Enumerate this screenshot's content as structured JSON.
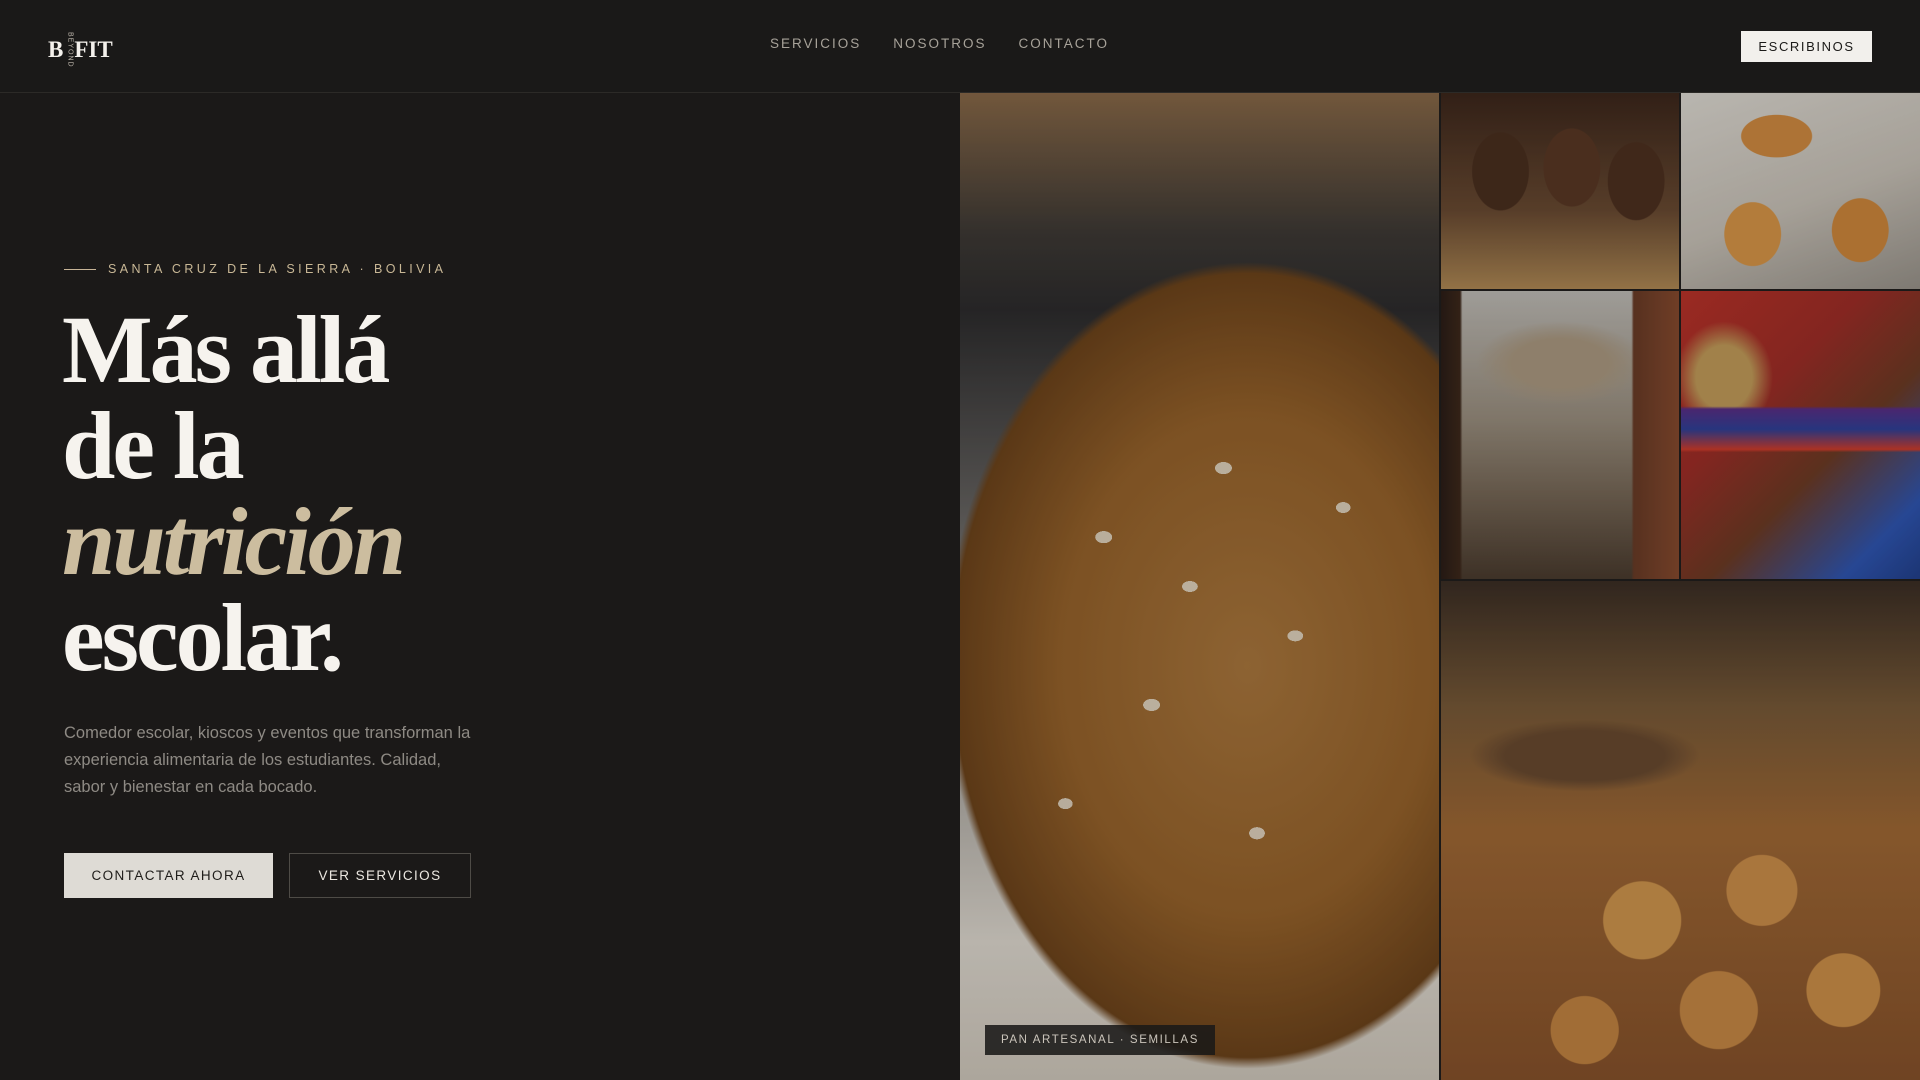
{
  "header": {
    "logo": {
      "left": "B",
      "vertical": "BEYOND",
      "right": "FIT"
    },
    "nav": [
      "SERVICIOS",
      "NOSOTROS",
      "CONTACTO"
    ],
    "cta": "ESCRIBINOS"
  },
  "hero": {
    "eyebrow": "SANTA CRUZ DE LA SIERRA · BOLIVIA",
    "title": {
      "line1": "Más allá",
      "line2": "de la",
      "line3": "nutrición",
      "line4": "escolar."
    },
    "description": "Comedor escolar, kioscos y eventos que transforman la experiencia alimentaria de los estudiantes. Calidad, sabor y bienestar en cada bocado.",
    "primary_button": "CONTACTAR AHORA",
    "secondary_button": "VER SERVICIOS"
  },
  "gallery": {
    "main_tag": "PAN ARTESANAL · SEMILLAS"
  }
}
